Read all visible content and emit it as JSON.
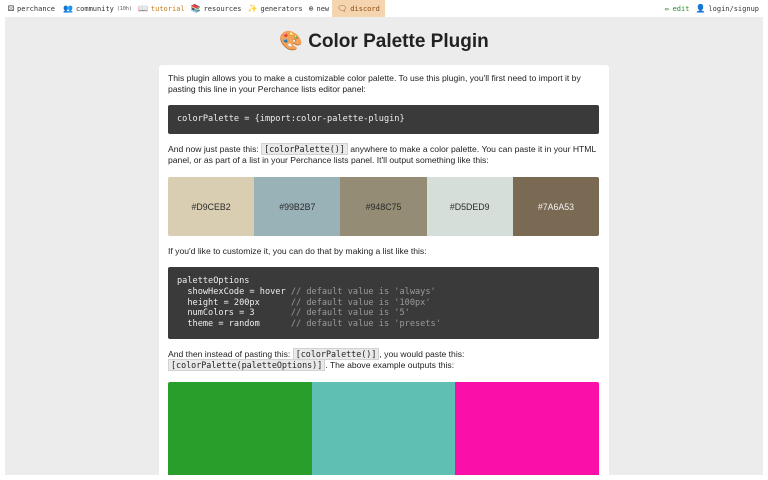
{
  "nav": {
    "brand": {
      "icon": "die-icon",
      "label": "perchance"
    },
    "community": {
      "icon": "people-icon",
      "label": "community",
      "count": "(10h)"
    },
    "tutorial": {
      "icon": "book-icon",
      "label": "tutorial"
    },
    "resources": {
      "icon": "library-icon",
      "label": "resources"
    },
    "generators": {
      "icon": "sparkle-icon",
      "label": "generators"
    },
    "new": {
      "icon": "plus-circle-icon",
      "label": "new"
    },
    "discord": {
      "icon": "chat-icon",
      "label": "discord"
    },
    "edit": {
      "icon": "pencil-icon",
      "label": "edit"
    },
    "login": {
      "icon": "user-icon",
      "label": "login/signup"
    }
  },
  "page": {
    "title_icon": "palette-icon",
    "title": "Color Palette Plugin",
    "intro": "This plugin allows you to make a customizable color palette. To use this plugin, you'll first need to import it by pasting this line in your Perchance lists editor panel:",
    "import_code": "colorPalette = {import:color-palette-plugin}",
    "paste_pre": "And now just paste this: ",
    "paste_code": "[colorPalette()]",
    "paste_post": " anywhere to make a color palette. You can paste it in your HTML panel, or as part of a list in your Perchance lists panel. It'll output something like this:",
    "customize": "If you'd like to customize it, you can do that by making a list like this:",
    "options_code": [
      {
        "code": "paletteOptions",
        "comment": ""
      },
      {
        "code": "  showHexCode = hover ",
        "comment": "// default value is 'always'"
      },
      {
        "code": "  height = 200px      ",
        "comment": "// default value is '100px'"
      },
      {
        "code": "  numColors = 3       ",
        "comment": "// default value is '5'"
      },
      {
        "code": "  theme = random      ",
        "comment": "// default value is 'presets'"
      }
    ],
    "instead_pre": "And then instead of pasting this: ",
    "instead_code1": "[colorPalette()]",
    "instead_mid": ", you would paste this:",
    "instead_code2": "[colorPalette(paletteOptions)]",
    "instead_post": ". The above example outputs this:"
  },
  "palette1": [
    {
      "hex": "#D9CEB2",
      "label": "#D9CEB2"
    },
    {
      "hex": "#99B2B7",
      "label": "#99B2B7"
    },
    {
      "hex": "#948C75",
      "label": "#948C75"
    },
    {
      "hex": "#D5DED9",
      "label": "#D5DED9"
    },
    {
      "hex": "#7A6A53",
      "label": "#7A6A53"
    }
  ],
  "palette2": [
    {
      "hex": "#2a9e2a"
    },
    {
      "hex": "#60bfb3"
    },
    {
      "hex": "#fa10a8"
    }
  ]
}
